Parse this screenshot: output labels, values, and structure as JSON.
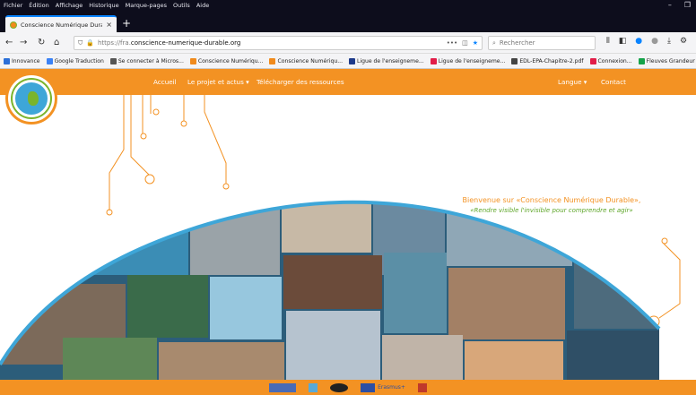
{
  "menu": [
    "Fichier",
    "Édition",
    "Affichage",
    "Historique",
    "Marque-pages",
    "Outils",
    "Aide"
  ],
  "tab": {
    "title": "Conscience Numérique Durable",
    "close": "×",
    "new": "+"
  },
  "nav": {
    "url_proto": "https://fra.",
    "url_host": "conscience-numerique-durable.org",
    "search_placeholder": "Rechercher",
    "more": "•••"
  },
  "bookmarks": [
    {
      "label": "Innovance",
      "color": "#2b6fd8"
    },
    {
      "label": "Google Traduction",
      "color": "#3b82f6"
    },
    {
      "label": "Se connecter à Micros...",
      "color": "#555555"
    },
    {
      "label": "Conscience Numériqu...",
      "color": "#f08a1c"
    },
    {
      "label": "Conscience Numériqu...",
      "color": "#f08a1c"
    },
    {
      "label": "Ligue de l'enseigneme...",
      "color": "#1e3a8a"
    },
    {
      "label": "Ligue de l'enseigneme...",
      "color": "#e11d48"
    },
    {
      "label": "EDL-EPA-Chapitre-2.pdf",
      "color": "#444444"
    },
    {
      "label": "Connexion...",
      "color": "#e11d48"
    },
    {
      "label": "Fleuves Grandeur Natu...",
      "color": "#16a34a"
    }
  ],
  "site": {
    "nav": {
      "home": "Accueil",
      "project": "Le projet et actus ▾",
      "download": "Télécharger des ressources",
      "lang": "Langue ▾",
      "contact": "Contact"
    },
    "welcome_1": "Bienvenue sur «Conscience Numérique Durable»,",
    "welcome_2": "«Rendre visible l'invisible pour comprendre et agir»",
    "footer": {
      "erasmus": "Erasmus+"
    }
  },
  "colors": {
    "orange": "#f39223",
    "green": "#5ea629",
    "blue": "#3ea6d8"
  }
}
